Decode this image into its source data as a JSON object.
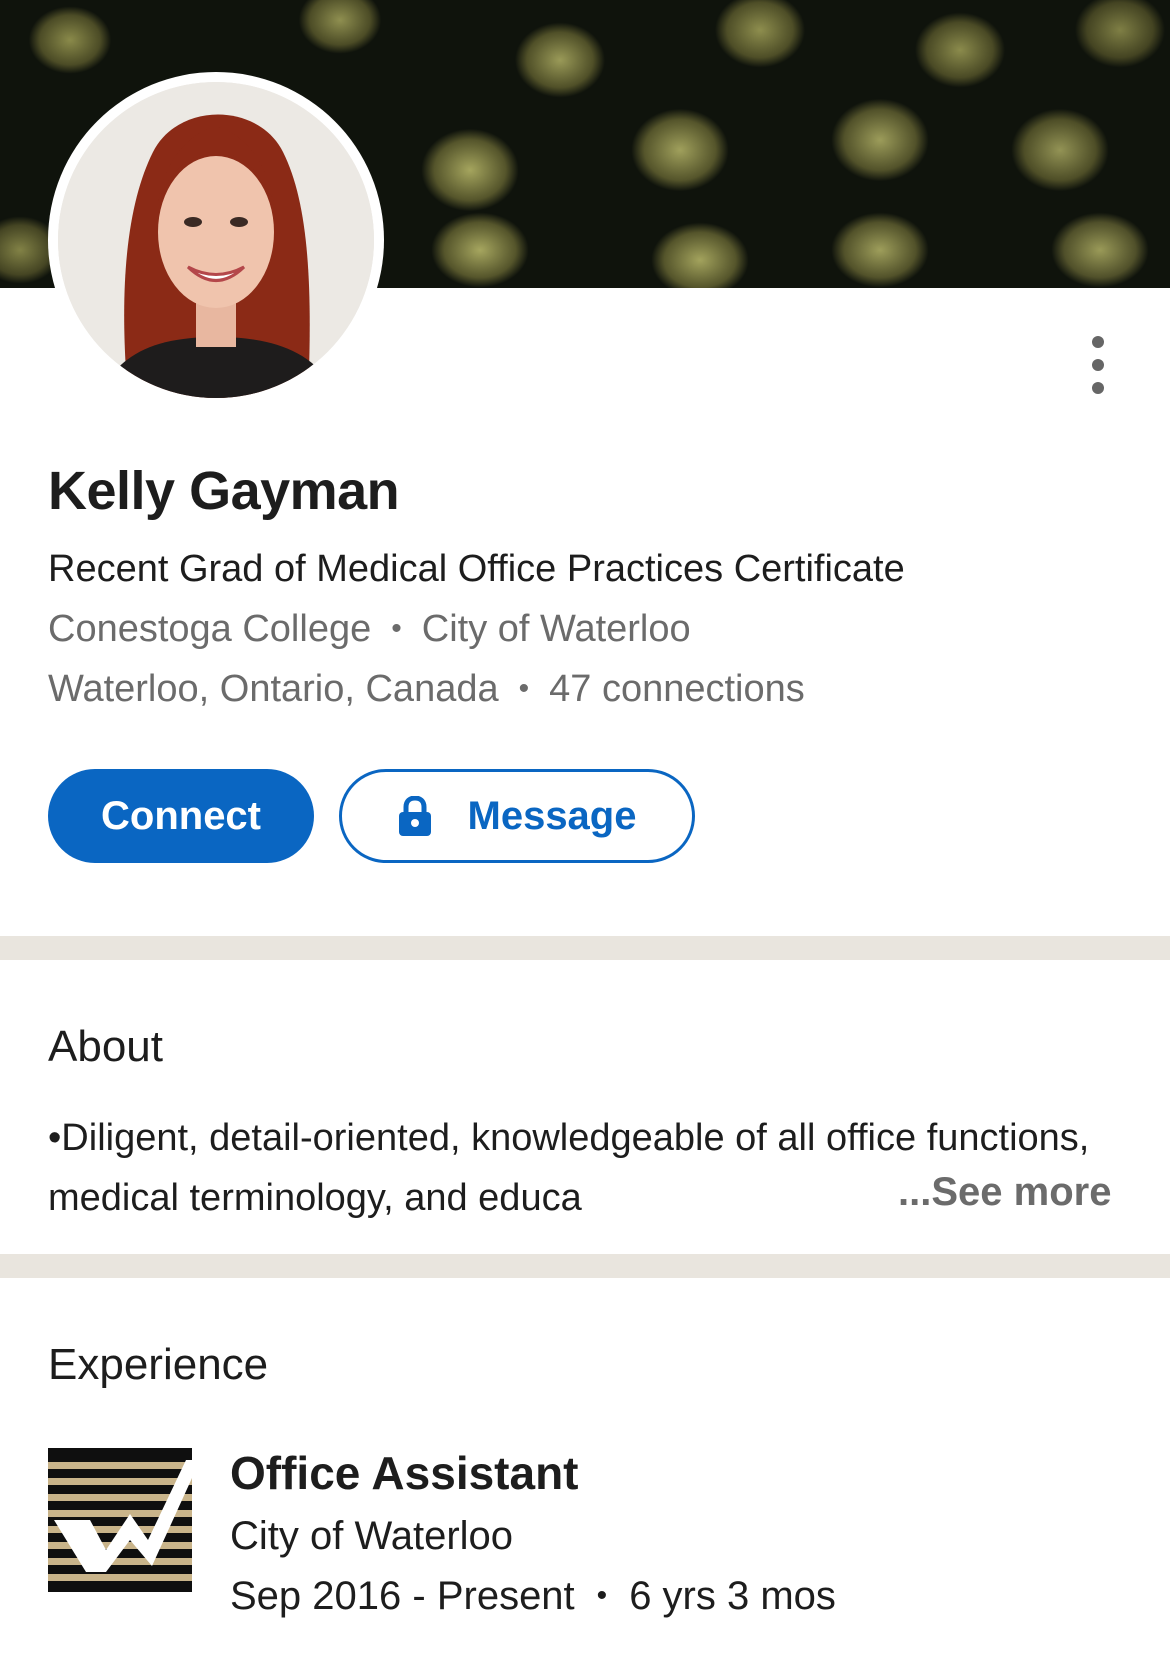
{
  "profile": {
    "name": "Kelly Gayman",
    "headline": "Recent Grad of Medical Office Practices Certificate",
    "education": "Conestoga College",
    "current_company": "City of Waterloo",
    "location": "Waterloo, Ontario, Canada",
    "connections": "47 connections",
    "separator": "•"
  },
  "actions": {
    "connect_label": "Connect",
    "message_label": "Message",
    "message_icon": "lock-icon",
    "more_icon": "more-vertical-icon"
  },
  "about": {
    "title": "About",
    "text": "•Diligent, detail-oriented, knowledgeable of all office functions, medical terminology, and educa",
    "see_more": "...See more"
  },
  "experience": {
    "title": "Experience",
    "items": [
      {
        "title": "Office Assistant",
        "organization": "City of Waterloo",
        "dates": "Sep 2016 - Present",
        "duration": "6 yrs 3 mos",
        "logo_icon": "city-of-waterloo-logo"
      }
    ]
  },
  "colors": {
    "primary": "#0a66c2",
    "secondary_text": "#6b6b6b",
    "divider": "#e9e5de"
  }
}
